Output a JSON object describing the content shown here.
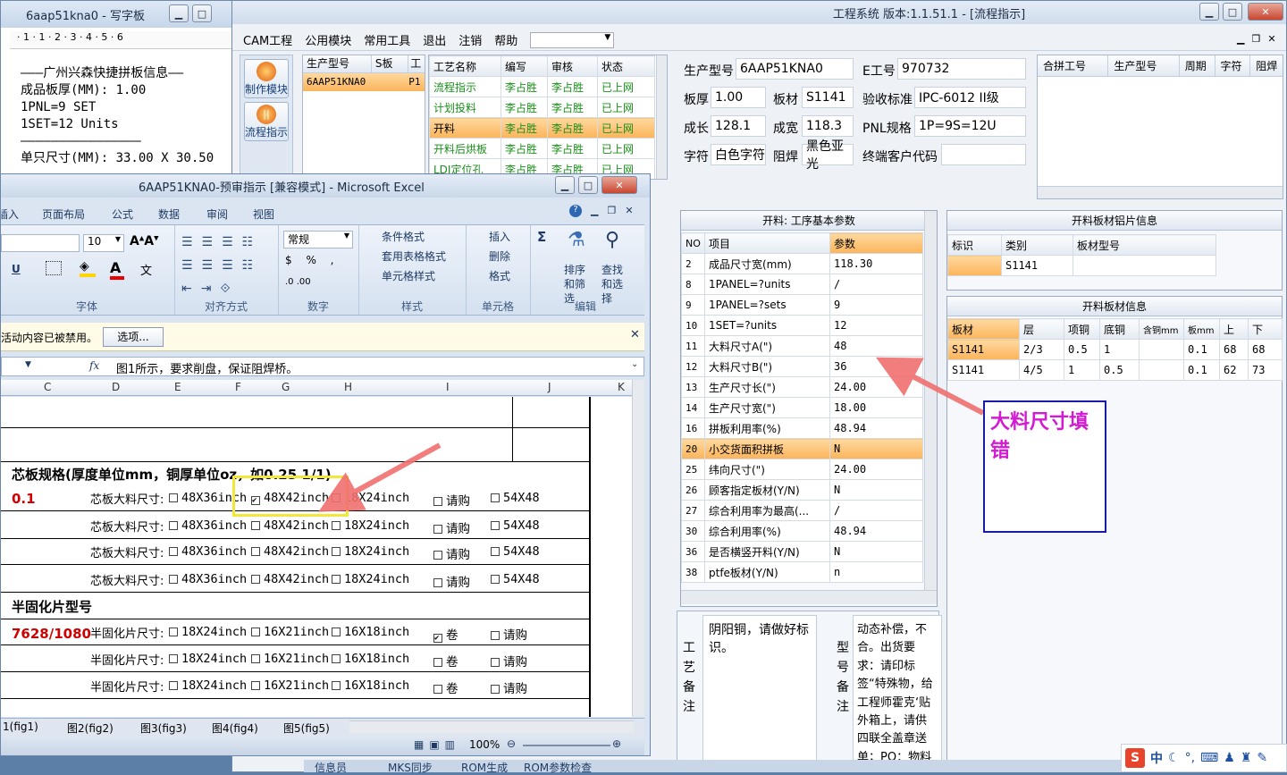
{
  "notepad": {
    "title": "6aap51kna0 - 写字板",
    "ruler": "· 1 · 1 · 2 · 3 · 4 · 5 · 6",
    "lines": [
      "———广州兴森快捷拼板信息——",
      "成品板厚(MM): 1.00",
      "1PNL=9 SET",
      "1SET=12 Units",
      "————————————————",
      "单只尺寸(MM): 33.00 X 30.50"
    ]
  },
  "main": {
    "title": "工程系统  版本:1.1.51.1 - [流程指示]",
    "menu": [
      "CAM工程",
      "公用模块",
      "常用工具",
      "退出",
      "注销",
      "帮助"
    ],
    "side": [
      {
        "label": "制作模块"
      },
      {
        "label": "流程指示"
      }
    ],
    "prod_headers": [
      "生产型号",
      "S板",
      "工"
    ],
    "prod_row": [
      "6AAP51KNA0",
      "P1"
    ],
    "process_headers": [
      "工艺名称",
      "编写",
      "审核",
      "状态"
    ],
    "process_rows": [
      [
        "流程指示",
        "李占胜",
        "李占胜",
        "已上网"
      ],
      [
        "计划投料",
        "李占胜",
        "李占胜",
        "已上网"
      ],
      [
        "开料",
        "李占胜",
        "李占胜",
        "已上网"
      ],
      [
        "开料后烘板",
        "李占胜",
        "李占胜",
        "已上网"
      ],
      [
        "LDI定位孔",
        "李占胜",
        "李占胜",
        "已上网"
      ]
    ],
    "info": {
      "prod_label": "生产型号",
      "prod": "6AAP51KNA0",
      "e_label": "E工号",
      "e": "970732",
      "thick_label": "板厚",
      "thick": "1.00",
      "mat_label": "板材",
      "mat": "S1141",
      "acc_label": "验收标准",
      "acc": "IPC-6012 II级",
      "len_label": "成长",
      "len": "128.1",
      "wid_label": "成宽",
      "wid": "118.3",
      "pnl_label": "PNL规格",
      "pnl": "1P=9S=12U",
      "char_label": "字符",
      "char": "白色字符",
      "mask_label": "阻焊",
      "mask": "黑色亚光",
      "cust_label": "终端客户代码",
      "cust": ""
    },
    "merge_headers": [
      "合拼工号",
      "生产型号",
      "周期",
      "字符",
      "阻焊"
    ],
    "params": {
      "title": "开料: 工序基本参数",
      "headers": [
        "NO",
        "项目",
        "参数"
      ],
      "rows": [
        [
          "2",
          "成品尺寸宽(mm)",
          "118.30"
        ],
        [
          "8",
          "1PANEL=?units",
          "/"
        ],
        [
          "9",
          "1PANEL=?sets",
          "9"
        ],
        [
          "10",
          "1SET=?units",
          "12"
        ],
        [
          "11",
          "大料尺寸A(\")",
          "48"
        ],
        [
          "12",
          "大料尺寸B(\")",
          "36"
        ],
        [
          "13",
          "生产尺寸长(\")",
          "24.00"
        ],
        [
          "14",
          "生产尺寸宽(\")",
          "18.00"
        ],
        [
          "16",
          "拼板利用率(%)",
          "48.94"
        ],
        [
          "20",
          "小交货面积拼板",
          "N"
        ],
        [
          "25",
          "纬向尺寸(\")",
          "24.00"
        ],
        [
          "26",
          "顾客指定板材(Y/N)",
          "N"
        ],
        [
          "27",
          "综合利用率为最高(...",
          "/"
        ],
        [
          "30",
          "综合利用率(%)",
          "48.94"
        ],
        [
          "36",
          "是否横竖开料(Y/N)",
          "N"
        ],
        [
          "38",
          "ptfe板材(Y/N)",
          "n"
        ]
      ]
    },
    "copper": {
      "title": "开料板材铝片信息",
      "headers": [
        "标识",
        "类别",
        "板材型号"
      ],
      "row": [
        "",
        "S1141",
        ""
      ]
    },
    "sheet": {
      "title": "开料板材信息",
      "headers": [
        "板材",
        "层",
        "项铜",
        "底铜",
        "含铜mm",
        "板mm",
        "上",
        "下"
      ],
      "rows": [
        [
          "S1141",
          "2/3",
          "0.5",
          "1",
          "",
          "0.1",
          "68",
          "68"
        ],
        [
          "S1141",
          "4/5",
          "1",
          "0.5",
          "",
          "0.1",
          "62",
          "73"
        ]
      ]
    },
    "craft_label": "工艺备注",
    "craft_text": "阴阳铜，请做好标识。",
    "model_label": "型号备注",
    "model_text": "动态补偿，不合。出货要求：请印标签“特殊物，给工程师霍克‘贴外箱上，请供四联全盖章送单；PO：物料"
  },
  "annotation": {
    "text": "大料尺寸填错",
    "color": "#d21bd2"
  },
  "excel": {
    "title": "6AAP51KNA0-预审指示 [兼容模式] - Microsoft Excel",
    "tabs": [
      "插入",
      "页面布局",
      "公式",
      "数据",
      "审阅",
      "视图"
    ],
    "font_size": "10",
    "number_format": "常规",
    "groups": [
      "字体",
      "对齐方式",
      "数字",
      "样式",
      "单元格",
      "编辑"
    ],
    "style_items": [
      "条件格式",
      "套用表格格式",
      "单元格样式"
    ],
    "cell_items": [
      "插入",
      "删除",
      "格式"
    ],
    "edit_items": [
      "排序和筛选",
      "查找和选择"
    ],
    "notice": "活动内容已被禁用。",
    "options_btn": "选项...",
    "formula": "图1所示，要求削盘，保证阻焊桥。",
    "cols": [
      "C",
      "D",
      "E",
      "F",
      "G",
      "H",
      "I",
      "J",
      "K"
    ],
    "section1": "芯板规格(厚度单位mm，铜厚单位oz，如0.25 1/1)",
    "core_value": "0.1",
    "core_label": "芯板大料尺寸:",
    "core_opts": [
      "48X36inch",
      "48X42inch",
      "18X24inch",
      "请购",
      "54X48"
    ],
    "section2": "半固化片型号",
    "pp_value": "7628/1080",
    "pp_label": "半固化片尺寸:",
    "pp_opts": [
      "18X24inch",
      "16X21inch",
      "16X18inch",
      "卷",
      "请购"
    ],
    "sheets": [
      "1(fig1)",
      "图2(fig2)",
      "图3(fig3)",
      "图4(fig4)",
      "图5(fig5)"
    ],
    "zoom": "100%"
  },
  "taskbar": {
    "items": [
      "信息员",
      "MKS同步",
      "ROM生成",
      "ROM参数检查"
    ],
    "tray": "中"
  }
}
